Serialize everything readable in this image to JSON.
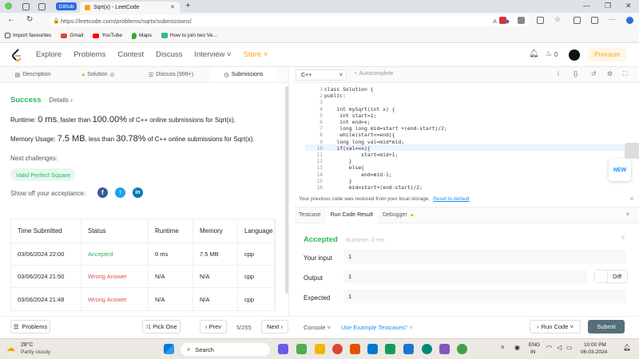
{
  "browser": {
    "tabs": [
      {
        "label": "Github"
      },
      {
        "label": "Sqrt(x) - LeetCode"
      }
    ],
    "new_tab": "+",
    "url": "https://leetcode.com/problems/sqrtx/submissions/",
    "bookmarks": [
      {
        "label": "Import favourites"
      },
      {
        "label": "Gmail"
      },
      {
        "label": "YouTube"
      },
      {
        "label": "Maps"
      },
      {
        "label": "How to join two Ve..."
      }
    ]
  },
  "nav": {
    "items": [
      "Explore",
      "Problems",
      "Contest",
      "Discuss",
      "Interview ˅",
      "Store ˅"
    ],
    "premium": "Premium",
    "streak": "0"
  },
  "left": {
    "tabs": [
      "Description",
      "Solution",
      "Discuss (999+)",
      "Submissions"
    ],
    "status": "Success",
    "details": "Details ›",
    "runtime_label": "Runtime:",
    "runtime_value": "0 ms",
    "runtime_mid": ", faster than ",
    "runtime_pct": "100.00%",
    "runtime_tail": " of C++ online submissions for Sqrt(x).",
    "memory_label": "Memory Usage:",
    "memory_value": "7.5 MB",
    "memory_mid": ", less than ",
    "memory_pct": "30.78%",
    "memory_tail": " of C++ online submissions for Sqrt(x).",
    "next_challenges": "Next challenges:",
    "challenge": "Valid Perfect Square",
    "share": "Show off your acceptance:",
    "table": {
      "headers": [
        "Time Submitted",
        "Status",
        "Runtime",
        "Memory",
        "Language"
      ],
      "rows": [
        {
          "time": "03/06/2024 22:00",
          "status": "Accepted",
          "runtime": "0 ms",
          "memory": "7.5 MB",
          "lang": "cpp"
        },
        {
          "time": "03/06/2024 21:50",
          "status": "Wrong Answer",
          "runtime": "N/A",
          "memory": "N/A",
          "lang": "cpp"
        },
        {
          "time": "03/06/2024 21:48",
          "status": "Wrong Answer",
          "runtime": "N/A",
          "memory": "N/A",
          "lang": "cpp"
        }
      ]
    }
  },
  "editor": {
    "language": "C++",
    "autocomplete": "Autocomplete",
    "new_badge": "NEW",
    "lines": [
      "class Solution {",
      "public:",
      "",
      "    int mySqrt(int x) {",
      "     int start=1;",
      "     int end=x;",
      "     long long mid=start +(end-start)/2;",
      "     while(start<=end){",
      "    long long val=mid*mid;",
      "    if(val<=x){",
      "            start=mid+1;",
      "        }",
      "        else{",
      "            end=mid-1;",
      "        }",
      "        mid=start+(end-start)/2;"
    ],
    "restore_msg": "Your previous code was restored from your local storage.",
    "reset": "Reset to default"
  },
  "result": {
    "tabs": [
      "Testcase",
      "Run Code Result",
      "Debugger"
    ],
    "status": "Accepted",
    "runtime": "Runtime: 0 ms",
    "your_input_label": "Your input",
    "your_input": "1",
    "output_label": "Output",
    "output": "1",
    "diff": "Diff",
    "expected_label": "Expected",
    "expected": "1"
  },
  "footer": {
    "problems": "Problems",
    "pick_one": "Pick One",
    "prev": "‹ Prev",
    "pager": "5/255",
    "next": "Next ›",
    "console": "Console ˅",
    "example": "Use Example Testcases",
    "help": "? ˅",
    "run": "Run Code ˅",
    "submit": "Submit"
  },
  "taskbar": {
    "temp": "28°C",
    "weather": "Partly cloudy",
    "search": "Search",
    "lang1": "ENG",
    "lang2": "IN",
    "time": "10:00 PM",
    "date": "06-03-2024"
  },
  "colors": {
    "accepted": "#2db55d",
    "wrong": "#d9534f",
    "lc_orange": "#ffa116",
    "link": "#1a90ff"
  }
}
